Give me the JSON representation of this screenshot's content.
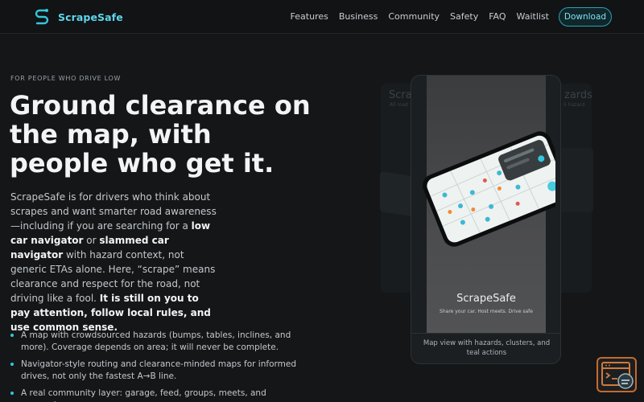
{
  "nav": {
    "brand": "ScrapeSafe",
    "links": [
      "Features",
      "Business",
      "Community",
      "Safety",
      "FAQ",
      "Waitlist"
    ],
    "cta": "Download"
  },
  "hero": {
    "eyebrow": "FOR PEOPLE WHO DRIVE LOW",
    "headline": "Ground clearance on the map, with people who get it.",
    "description": {
      "p1": "ScrapeSafe is for drivers who think about scrapes and want smarter road awareness—including if you are searching for a ",
      "b1": "low car navigator",
      "p2": " or ",
      "b2": "slammed car navigator",
      "p3": " with hazard context, not generic ETAs alone. Here, “scrape” means clearance and respect for the road, not driving like a fool. ",
      "b3": "It is still on you to pay attention, follow local rules, and use common sense."
    },
    "bullets": [
      "A map with crowdsourced hazards (bumps, tables, inclines, and more). Coverage depends on area; it will never be complete.",
      "Navigator-style routing and clearance-minded maps for informed drives, not only the fastest A→B line.",
      "A real community layer: garage, feed, groups, meets, and messaging"
    ]
  },
  "showcase": {
    "bg_left_title": "Scra",
    "bg_left_sub": "All road",
    "bg_right_title": "zards",
    "bg_right_sub": "5 hazard",
    "app_name": "ScrapeSafe",
    "tagline": "Share your car. Host meets. Drive safe",
    "caption": "Map view with hazards, clusters, and teal actions"
  },
  "colors": {
    "accent": "#34c6dd",
    "background": "#141618",
    "chat_border": "#c46a2e"
  },
  "icons": {
    "brand": "s-route-logo-icon",
    "chat": "chat-assistant-icon"
  }
}
